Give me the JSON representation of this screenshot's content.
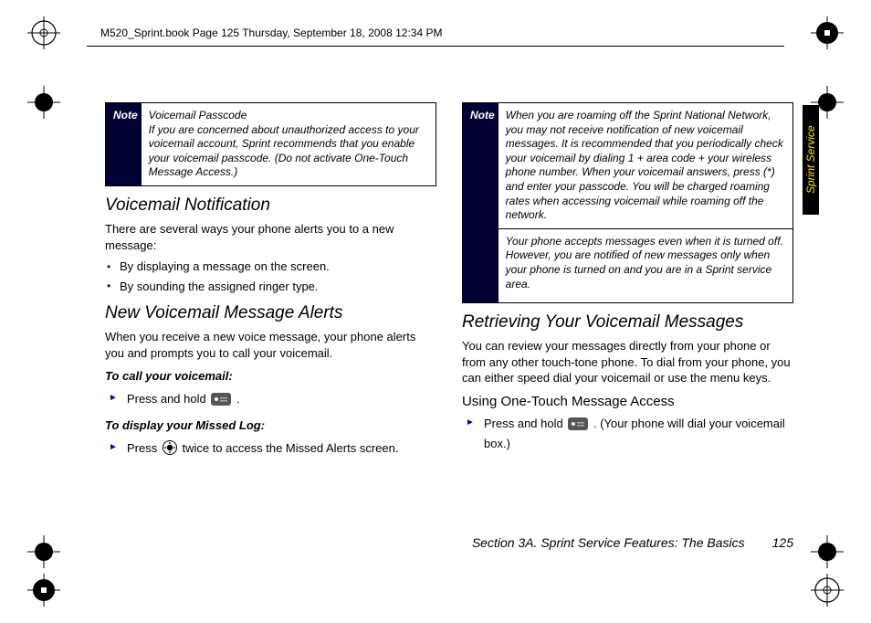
{
  "header": {
    "text": "M520_Sprint.book  Page 125  Thursday, September 18, 2008  12:34 PM"
  },
  "side_tab": "Sprint Service",
  "left": {
    "note": {
      "label": "Note",
      "title": "Voicemail Passcode",
      "body": "If you are concerned about unauthorized access to your voicemail account, Sprint recommends that you enable your voicemail passcode. (Do not activate One-Touch Message Access.)"
    },
    "h1": "Voicemail Notification",
    "p1": "There are several ways your phone alerts you to a new message:",
    "bullets": [
      "By displaying a message on the screen.",
      "By sounding the assigned ringer type."
    ],
    "h2": "New Voicemail Message Alerts",
    "p2": "When you receive a new voice message, your phone alerts you and prompts you to call your voicemail.",
    "inst1": "To call your voicemail:",
    "step1a": "Press and hold ",
    "step1b": ".",
    "inst2": "To display your Missed Log:",
    "step2a": "Press ",
    "step2b": " twice to access the Missed Alerts screen."
  },
  "right": {
    "note": {
      "label": "Note",
      "body1": "When you are roaming off the Sprint National Network, you may not receive notification of new voicemail messages. It is recommended that you periodically check your voicemail by dialing 1 + area code + your wireless phone number. When your voicemail answers, press (*) and enter your passcode. You will be charged roaming rates when accessing voicemail while roaming off the network.",
      "body2": "Your phone accepts messages even when it is turned off. However, you are notified of new messages only when your phone is turned on and you are in a Sprint service area."
    },
    "h1": "Retrieving Your Voicemail Messages",
    "p1": "You can review your messages directly from your phone or from any other touch-tone phone. To dial from your phone, you can either speed dial your voicemail or use the menu keys.",
    "h2": "Using One-Touch Message Access",
    "step1a": "Press and hold ",
    "step1b": ". (Your phone will dial your voicemail box.)"
  },
  "footer": {
    "section": "Section 3A. Sprint Service Features: The Basics",
    "page": "125"
  }
}
